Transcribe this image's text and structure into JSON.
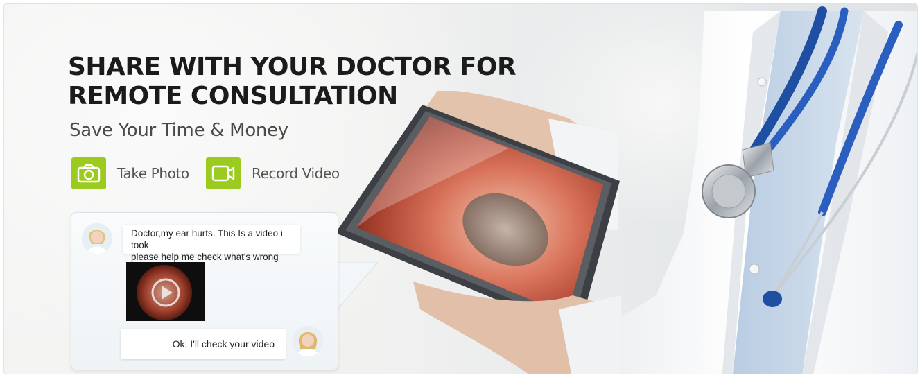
{
  "hero": {
    "headline_line1": "SHARE WITH YOUR DOCTOR FOR",
    "headline_line2": "REMOTE CONSULTATION",
    "subheadline": "Save Your Time & Money"
  },
  "features": [
    {
      "label": "Take Photo",
      "icon": "camera-icon"
    },
    {
      "label": "Record Video",
      "icon": "video-camera-icon"
    }
  ],
  "chat": {
    "patient_message_line1": "Doctor,my ear hurts. This Is a video i took",
    "patient_message_line2": "please help me check what's wrong",
    "doctor_reply": "Ok, I'll check your video"
  },
  "colors": {
    "accent_green": "#9ccb1f",
    "headline_text": "#1b1b1b",
    "stethoscope_blue": "#1f4fa3"
  }
}
